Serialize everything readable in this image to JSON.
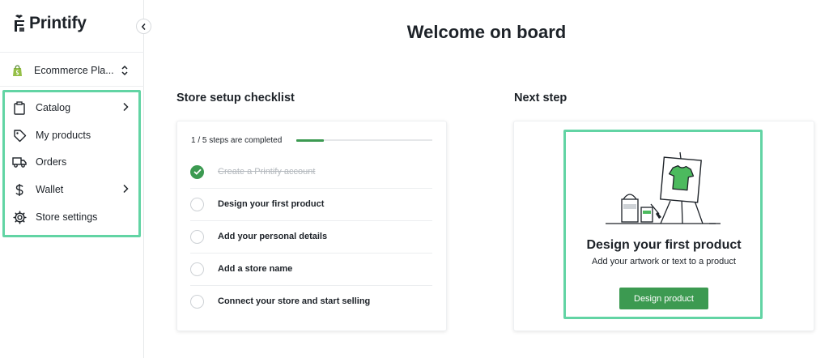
{
  "brand": {
    "name": "Printify",
    "accent": "#3c9a51",
    "highlight": "#62d4a4"
  },
  "sidebar": {
    "collapse_icon": "chevron-left-icon",
    "store": {
      "name": "Ecommerce Pla...",
      "icon": "shopify-bag-icon",
      "switch_icon": "chevron-up-down-icon"
    },
    "items": [
      {
        "label": "Catalog",
        "icon": "clipboard-icon",
        "has_submenu": true
      },
      {
        "label": "My products",
        "icon": "tag-icon",
        "has_submenu": false
      },
      {
        "label": "Orders",
        "icon": "truck-icon",
        "has_submenu": false
      },
      {
        "label": "Wallet",
        "icon": "dollar-icon",
        "has_submenu": true
      },
      {
        "label": "Store settings",
        "icon": "gear-icon",
        "has_submenu": false
      }
    ]
  },
  "main": {
    "title": "Welcome on board",
    "checklist": {
      "heading": "Store setup checklist",
      "progress_text": "1 / 5 steps are completed",
      "progress_fraction": 0.2,
      "tasks": [
        {
          "label": "Create a Printify account",
          "done": true
        },
        {
          "label": "Design your first product",
          "done": false
        },
        {
          "label": "Add your personal details",
          "done": false
        },
        {
          "label": "Add a store name",
          "done": false
        },
        {
          "label": "Connect your store and start selling",
          "done": false
        }
      ]
    },
    "next_step": {
      "heading": "Next step",
      "title": "Design your first product",
      "subtitle": "Add your artwork or text to a product",
      "button": "Design product",
      "illustration": "easel-tshirt-illustration"
    }
  }
}
